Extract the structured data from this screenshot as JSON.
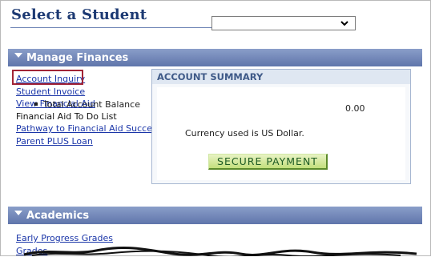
{
  "header": {
    "title": "Select a Student",
    "student_select_value": ""
  },
  "manage_finances": {
    "title": "Manage Finances",
    "links": [
      {
        "label": "Account Inquiry",
        "link": true
      },
      {
        "label": "Student Invoice",
        "link": true
      },
      {
        "label": "View Financial Aid",
        "link": true
      },
      {
        "label": "Financial Aid To Do List",
        "link": false
      },
      {
        "label": "Pathway to Financial Aid Success",
        "link": true
      },
      {
        "label": "Parent PLUS Loan",
        "link": true
      }
    ]
  },
  "account_summary": {
    "title": "ACCOUNT SUMMARY",
    "balance_label": "Total Account Balance",
    "balance_value": "0.00",
    "currency_note": "Currency used is US Dollar.",
    "button_label": "SECURE PAYMENT"
  },
  "academics": {
    "title": "Academics",
    "links": [
      {
        "label": "Early Progress Grades"
      },
      {
        "label": "Grades"
      }
    ]
  },
  "colors": {
    "section_bar": "#6f84b8",
    "link": "#1a35a8",
    "highlight": "#a22436",
    "button": "#c3df7c"
  },
  "icons": [
    "chevron-down-icon",
    "section-expanded-triangle-icon"
  ]
}
